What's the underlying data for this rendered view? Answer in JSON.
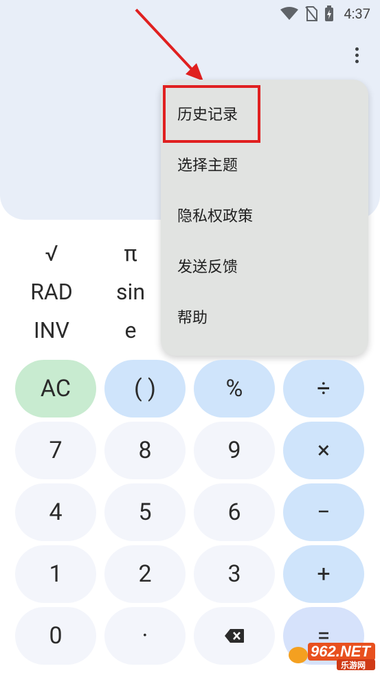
{
  "status_bar": {
    "time": "4:37",
    "icons": [
      "wifi-icon",
      "no-sim-icon",
      "battery-charging-icon"
    ]
  },
  "overflow_menu": {
    "items": [
      {
        "label": "历史记录",
        "highlighted": true
      },
      {
        "label": "选择主题"
      },
      {
        "label": "隐私权政策"
      },
      {
        "label": "发送反馈"
      },
      {
        "label": "帮助"
      }
    ]
  },
  "scientific": {
    "col1": [
      "√",
      "RAD",
      "INV"
    ],
    "col2": [
      "π",
      "sin",
      "e"
    ]
  },
  "keypad": {
    "row1": [
      "AC",
      "( )",
      "%",
      "÷"
    ],
    "row2": [
      "7",
      "8",
      "9",
      "×"
    ],
    "row3": [
      "4",
      "5",
      "6",
      "−"
    ],
    "row4": [
      "1",
      "2",
      "3",
      "+"
    ],
    "row5": [
      "0",
      "·",
      "backspace-icon",
      "="
    ]
  },
  "watermark": {
    "main": "962.NET",
    "sub": "乐游网"
  },
  "colors": {
    "highlight": "#e02020",
    "display": "#e8eef8",
    "operator": "#cfe4fb",
    "ac": "#c8ebd0",
    "menu": "#e1e3e1"
  }
}
